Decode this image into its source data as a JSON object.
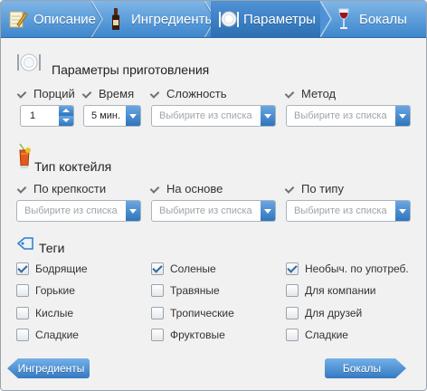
{
  "tabs": [
    {
      "label": "Описание",
      "icon": "notepad-pencil-icon"
    },
    {
      "label": "Ингредиенты",
      "icon": "bottle-icon"
    },
    {
      "label": "Параметры",
      "icon": "plate-cutlery-icon",
      "active": true
    },
    {
      "label": "Бокалы",
      "icon": "wine-glass-icon"
    }
  ],
  "prep": {
    "title": "Параметры приготовления",
    "icon": "plate-cutlery-icon",
    "portions_label": "Порций",
    "portions_value": "1",
    "time_label": "Время",
    "time_value": "5 мин.",
    "complexity_label": "Сложность",
    "complexity_placeholder": "Выбирите из списка",
    "method_label": "Метод",
    "method_placeholder": "Выбирите из списка"
  },
  "cocktail": {
    "title": "Тип коктейля",
    "icon": "cocktail-glass-icon",
    "strength_label": "По крепкости",
    "strength_placeholder": "Выбирите из списка",
    "base_label": "На основе",
    "base_placeholder": "Выбирите из списка",
    "type_label": "По типу",
    "type_placeholder": "Выбирите из списка"
  },
  "tags": {
    "title": "Теги",
    "icon": "tag-icon",
    "items": [
      {
        "label": "Бодрящие",
        "checked": true
      },
      {
        "label": "Соленые",
        "checked": true
      },
      {
        "label": "Необыч. по употреб.",
        "checked": true
      },
      {
        "label": "Горькие",
        "checked": false
      },
      {
        "label": "Травяные",
        "checked": false
      },
      {
        "label": "Для компании",
        "checked": false
      },
      {
        "label": "Кислые",
        "checked": false
      },
      {
        "label": "Тропические",
        "checked": false
      },
      {
        "label": "Для друзей",
        "checked": false
      },
      {
        "label": "Сладкие",
        "checked": false
      },
      {
        "label": "Фруктовые",
        "checked": false
      },
      {
        "label": "Сладкие",
        "checked": false
      }
    ]
  },
  "nav": {
    "prev_label": "Ингредиенты",
    "next_label": "Бокалы"
  },
  "colors": {
    "accent": "#3d86cc",
    "tab_bar_top": "#7fb6e8",
    "panel": "#f1f1f1"
  }
}
